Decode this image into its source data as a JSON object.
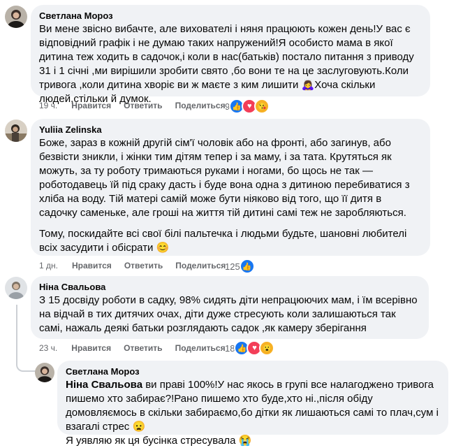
{
  "comments": [
    {
      "author": "Светлана Мороз",
      "text": "Ви мене звісно вибачте, але вихователі і няня працюють кожен день!У вас є відповідний графік і не думаю таких напружений!Я особисто мама в якої дитина теж ходить в садочок,і коли в нас(батьків) постало питання з приводу 31 і 1 січні ,ми вирішили зробити свято ,бо вони те на це заслуговують.Коли тривога ,коли дитина хворіє ви ж маєте з ким лишити 🙇‍♀️Хоча скільки людей,стільки й думок.",
      "time": "19 ч.",
      "like_label": "Нравится",
      "reply_label": "Ответить",
      "share_label": "Поделиться",
      "reaction_count": "9",
      "reactions": [
        "like",
        "heart",
        "care"
      ]
    },
    {
      "author": "Yuliia Zelinska",
      "paragraphs": [
        "Боже, зараз в кожній другій сім'ї чоловік або на фронті, або загинув, або безвісти зникли, і жінки тим дітям тепер і за маму, і за тата. Крутяться як можуть, за ту роботу тримаються руками і ногами, бо щось не так — роботодавець їй під сраку дасть і буде вона одна з дитиною перебиватися з хліба на воду. Тій матері самій може бути ніяково від того, що її дитя в садочку саменьке, але гроші на життя тій дитині самі теж не заробляються.",
        "Тому, поскидайте всі свої білі пальтечка і людьми будьте, шановні любителі всіх засудити і обісрати 😊"
      ],
      "time": "1 дн.",
      "like_label": "Нравится",
      "reply_label": "Ответить",
      "share_label": "Поделиться",
      "reaction_count": "125",
      "reactions": [
        "like"
      ]
    },
    {
      "author": "Ніна Свальова",
      "text": "З 15 досвіду роботи в садку, 98% сидять діти непрацюючих мам, і їм всерівно на відчай в тих дитячих очах, діти дуже стресують коли залишаються так самі, нажаль деякі батьки розглядають садок ,як камеру зберігання",
      "time": "23 ч.",
      "like_label": "Нравится",
      "reply_label": "Ответить",
      "share_label": "Поделиться",
      "reaction_count": "18",
      "reactions": [
        "like",
        "heart",
        "wow"
      ]
    },
    {
      "author": "Светлана Мороз",
      "mention": "Ніна Свальова",
      "text": " ви праві 100%!У нас якось в групі все налагоджено тривога пишемо хто забирає?!Рано пишемо хто буде,хто ні.,після обіду домовляємось в скільки забираємо,бо дітки як лишаються самі то плач,сум і взагалі стрес 😦",
      "text2": "Я уявляю як ця бусінка стресувала 😭"
    }
  ],
  "colors": {
    "bubble": "#f0f2f5",
    "meta": "#65676b",
    "like": "#1877f2",
    "heart": "#f33e58",
    "wow": "#f7b125"
  }
}
